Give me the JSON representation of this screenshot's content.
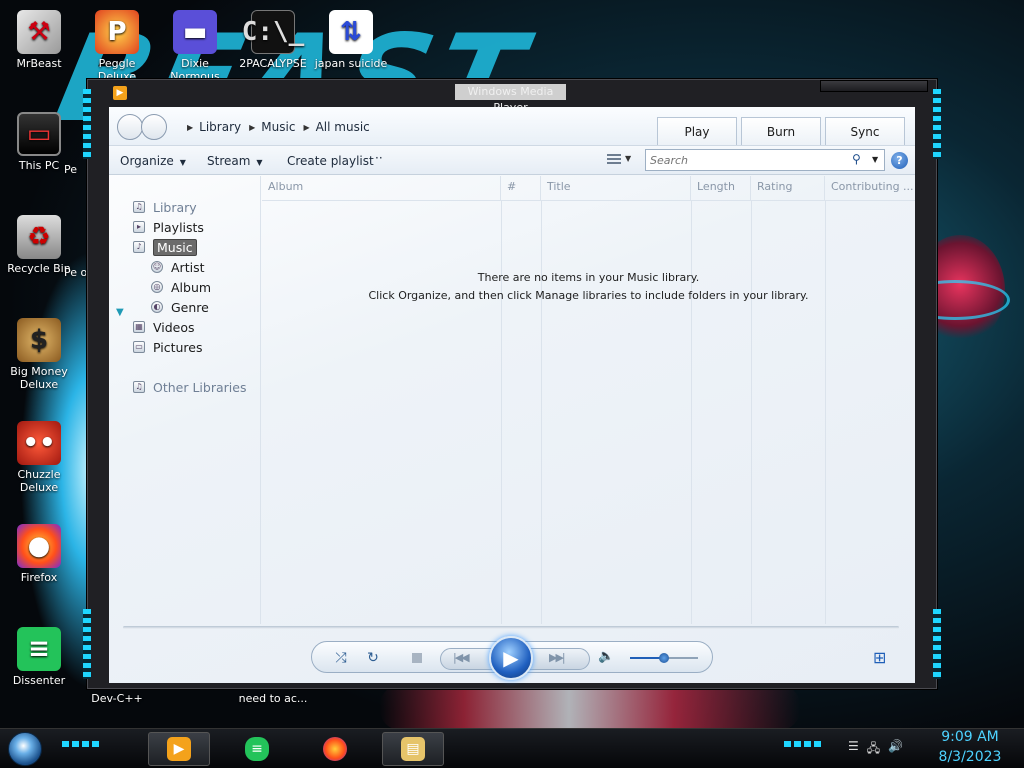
{
  "desktop": {
    "icons": [
      {
        "label": "MrBeast",
        "glyph": "⚒"
      },
      {
        "label": "Peggle Deluxe",
        "glyph": "P"
      },
      {
        "label": "Dixie Normous",
        "glyph": "▬"
      },
      {
        "label": "2PACALYPSE",
        "glyph": "C:\\_"
      },
      {
        "label": "japan suicide",
        "glyph": "⇅"
      },
      {
        "label": "This PC",
        "glyph": "▭"
      },
      {
        "label": "Recycle Bin",
        "glyph": "♻"
      },
      {
        "label": "Big Money Deluxe",
        "glyph": "$"
      },
      {
        "label": "Chuzzle Deluxe",
        "glyph": "••"
      },
      {
        "label": "Firefox",
        "glyph": "●"
      },
      {
        "label": "Dissenter",
        "glyph": "≡"
      }
    ],
    "partial_labels": [
      "Pe",
      "Pe of",
      "Dev-C++",
      "need to ac..."
    ]
  },
  "wmp": {
    "title": "Windows Media Player",
    "breadcrumb": [
      "Library",
      "Music",
      "All music"
    ],
    "tabs": {
      "play": "Play",
      "burn": "Burn",
      "sync": "Sync"
    },
    "commands": {
      "organize": "Organize",
      "stream": "Stream",
      "create_playlist": "Create playlist",
      "more": "··"
    },
    "search": {
      "placeholder": "Search"
    },
    "nav": {
      "library": "Library",
      "playlists": "Playlists",
      "music": "Music",
      "artist": "Artist",
      "album": "Album",
      "genre": "Genre",
      "videos": "Videos",
      "pictures": "Pictures",
      "other_libraries": "Other Libraries"
    },
    "columns": {
      "album": "Album",
      "number": "#",
      "title": "Title",
      "length": "Length",
      "rating": "Rating",
      "contributing": "Contributing ..."
    },
    "empty_line1": "There are no items in your Music library.",
    "empty_line2": "Click Organize, and then click Manage libraries to include folders in your library.",
    "volume_level": 0.5
  },
  "taskbar": {
    "time": "9:09 AM",
    "date": "8/3/2023"
  },
  "colors": {
    "accent": "#1fd6ff",
    "clock": "#4dd2ff",
    "wmp_blue": "#1f5fb8"
  }
}
